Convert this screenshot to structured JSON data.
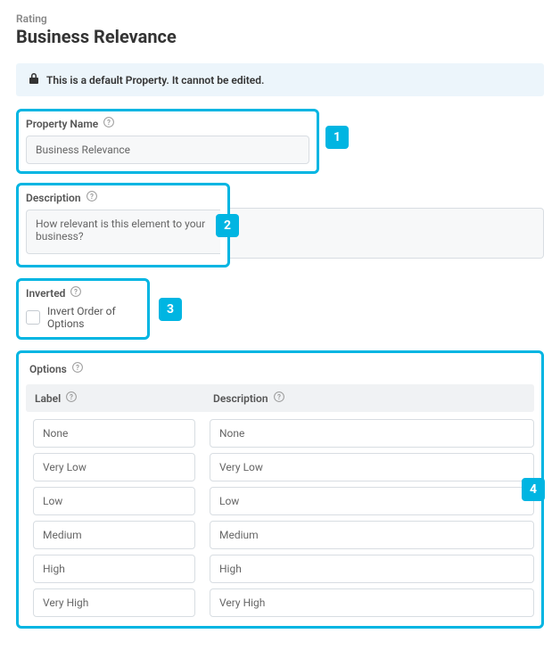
{
  "breadcrumb": "Rating",
  "title": "Business Relevance",
  "notice": "This is a default Property. It cannot be edited.",
  "markers": {
    "m1": "1",
    "m2": "2",
    "m3": "3",
    "m4": "4"
  },
  "propertyName": {
    "label": "Property Name",
    "value": "Business Relevance"
  },
  "description": {
    "label": "Description",
    "value": "How relevant is this element to your business?"
  },
  "inverted": {
    "label": "Inverted",
    "checkLabel": "Invert Order of Options",
    "checked": false
  },
  "options": {
    "label": "Options",
    "columns": {
      "label": "Label",
      "description": "Description"
    },
    "rows": [
      {
        "label": "None",
        "description": "None"
      },
      {
        "label": "Very Low",
        "description": "Very Low"
      },
      {
        "label": "Low",
        "description": "Low"
      },
      {
        "label": "Medium",
        "description": "Medium"
      },
      {
        "label": "High",
        "description": "High"
      },
      {
        "label": "Very High",
        "description": "Very High"
      }
    ]
  }
}
